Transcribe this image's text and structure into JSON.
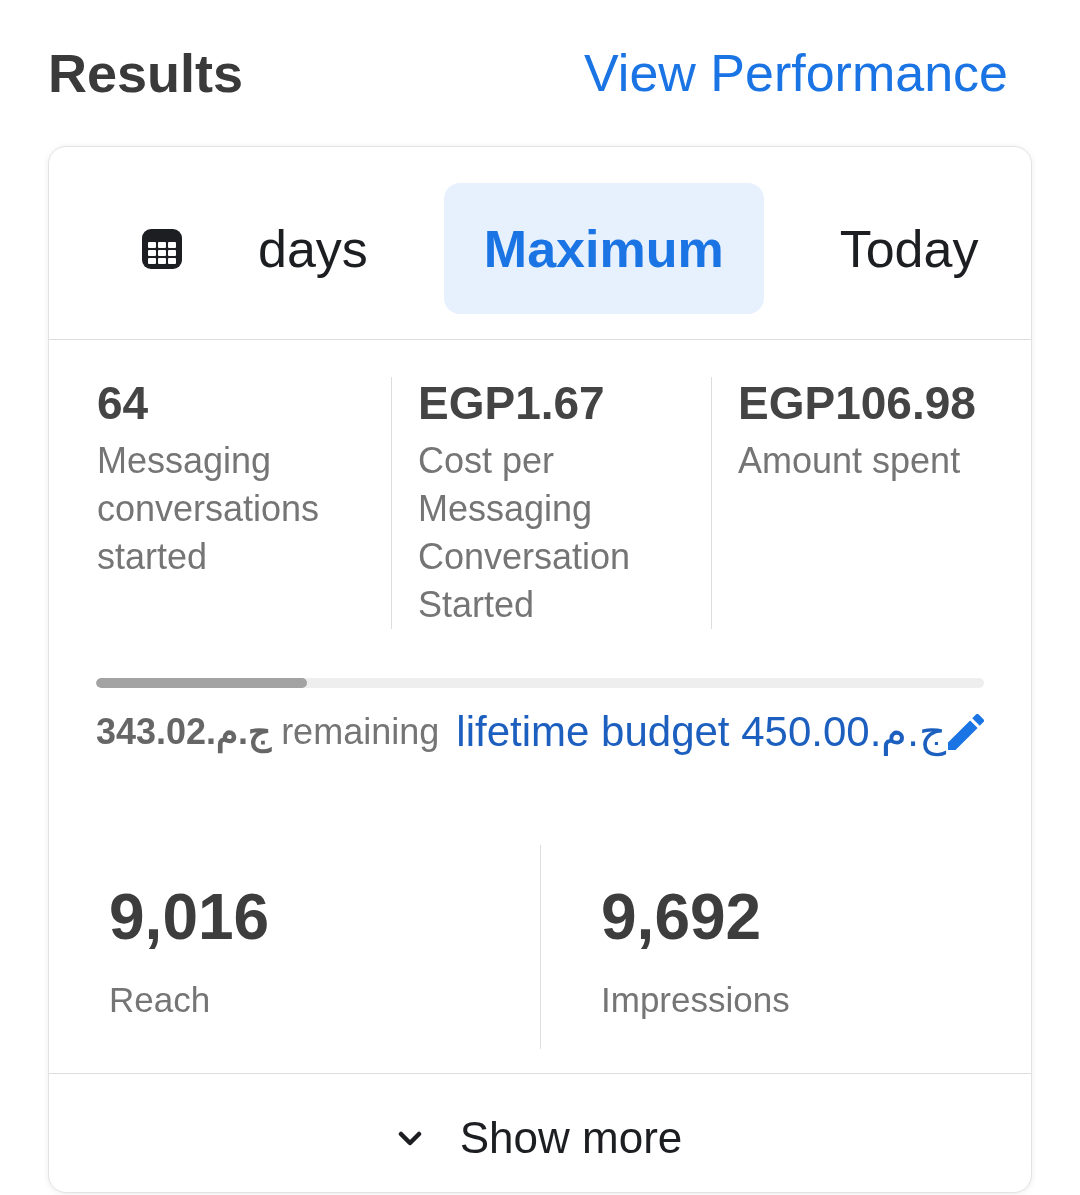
{
  "header": {
    "title": "Results",
    "link": "View Performance"
  },
  "tabs": [
    {
      "label": "days",
      "selected": false
    },
    {
      "label": "Maximum",
      "selected": true
    },
    {
      "label": "Today",
      "selected": false
    }
  ],
  "metrics": [
    {
      "value": "64",
      "label": "Messaging conversations started"
    },
    {
      "value": "EGP1.67",
      "label": "Cost per Messaging Conversation Started"
    },
    {
      "value": "EGP106.98",
      "label": "Amount spent"
    }
  ],
  "budget": {
    "level": 0.238,
    "remaining": "**343.02ج.م.‏** remaining",
    "lifetime": "lifetime budget 450.00ج.م.‏"
  },
  "totals": [
    {
      "value": "9,016",
      "label": "Reach"
    },
    {
      "value": "9,692",
      "label": "Impressions"
    }
  ],
  "show_more": {
    "label": "Show more",
    "expanded": false
  }
}
